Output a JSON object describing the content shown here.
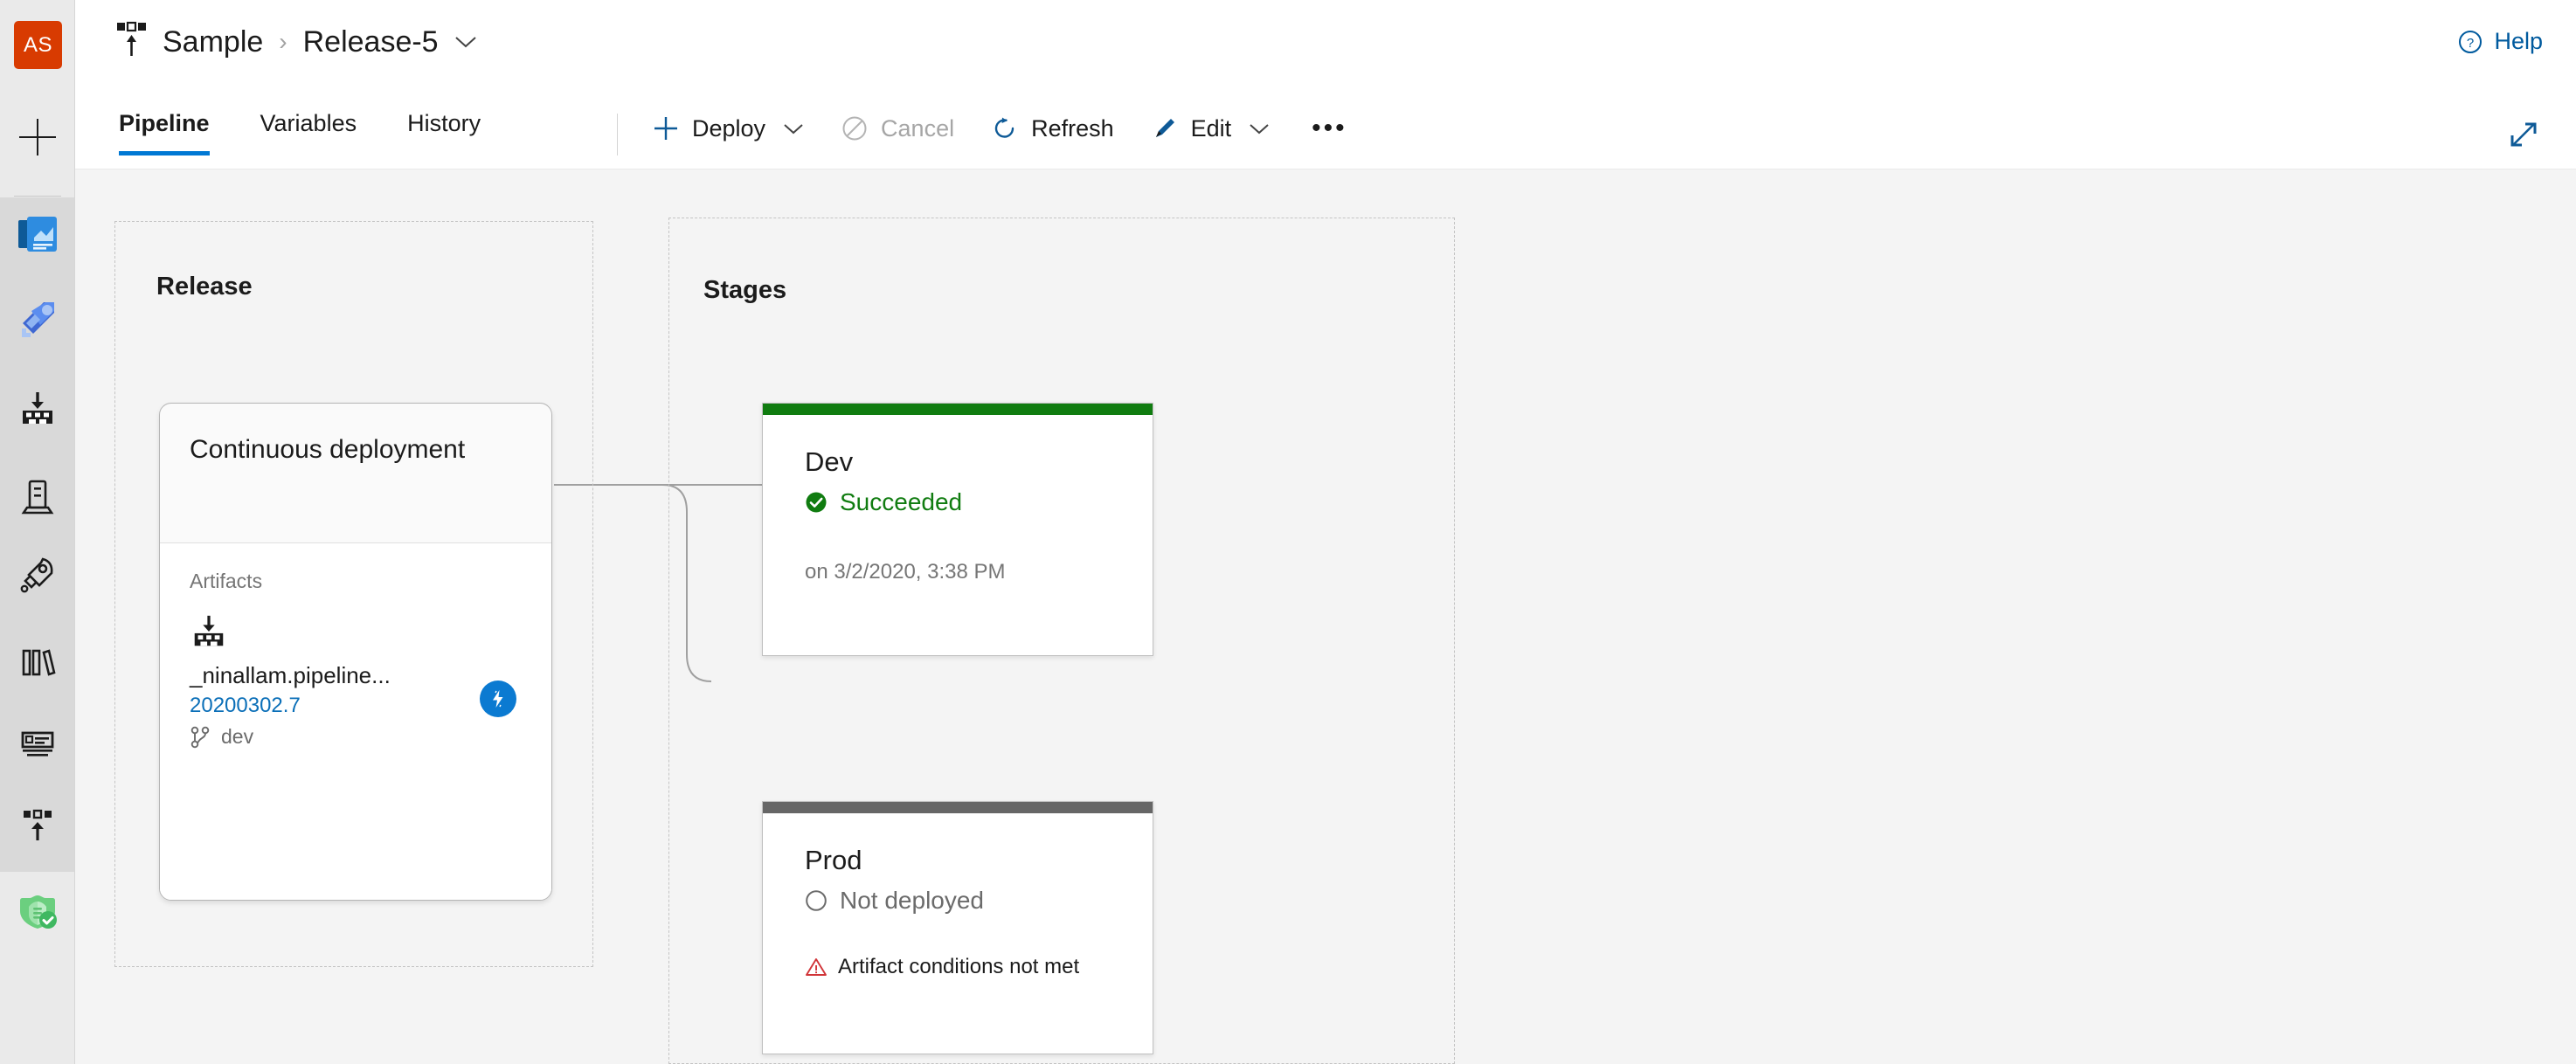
{
  "rail": {
    "avatar_initials": "AS",
    "items": [
      {
        "name": "add-icon",
        "label": "New"
      },
      {
        "name": "boards-icon",
        "label": "Boards"
      },
      {
        "name": "pipelines-icon",
        "label": "Pipelines"
      },
      {
        "name": "artifact-download-icon",
        "label": "Artifacts"
      },
      {
        "name": "server-icon",
        "label": "Deployment groups"
      },
      {
        "name": "rocket-icon",
        "label": "Releases"
      },
      {
        "name": "library-icon",
        "label": "Library"
      },
      {
        "name": "task-groups-icon",
        "label": "Task groups"
      },
      {
        "name": "artifact-upload-icon",
        "label": "Artifacts"
      },
      {
        "name": "security-shield-icon",
        "label": "Security"
      }
    ]
  },
  "header": {
    "breadcrumb_icon": "release-pipeline-icon",
    "project": "Sample",
    "separator": "›",
    "release": "Release-5",
    "chevron": "chevron-down-icon",
    "help_label": "Help",
    "help_icon": "help-circle-icon"
  },
  "toolbar": {
    "tabs": [
      {
        "label": "Pipeline",
        "active": true
      },
      {
        "label": "Variables",
        "active": false
      },
      {
        "label": "History",
        "active": false
      }
    ],
    "buttons": [
      {
        "label": "Deploy",
        "icon": "plus-icon",
        "chevron": true,
        "disabled": false
      },
      {
        "label": "Cancel",
        "icon": "cancel-circle-icon",
        "chevron": false,
        "disabled": true
      },
      {
        "label": "Refresh",
        "icon": "refresh-icon",
        "chevron": false,
        "disabled": false
      },
      {
        "label": "Edit",
        "icon": "pencil-icon",
        "chevron": true,
        "disabled": false
      }
    ],
    "overflow_label": "•••",
    "expand_icon": "expand-diagonal-icon"
  },
  "canvas": {
    "release_group": {
      "title": "Release",
      "card": {
        "title": "Continuous deployment",
        "artifacts_label": "Artifacts",
        "artifact": {
          "icon": "artifact-download-icon",
          "name": "_ninallam.pipeline...",
          "version": "20200302.7",
          "branch_icon": "branch-icon",
          "branch": "dev",
          "trigger_icon": "lightning-bolt-icon"
        }
      }
    },
    "stages_group": {
      "title": "Stages",
      "stages": [
        {
          "name": "Dev",
          "bar_color": "#107c10",
          "status_icon": "check-circle-icon",
          "status_text": "Succeeded",
          "status_color": "#107c10",
          "meta": "on 3/2/2020, 3:38 PM"
        },
        {
          "name": "Prod",
          "bar_color": "#666666",
          "status_icon": "empty-circle-icon",
          "status_text": "Not deployed",
          "status_color": "#6b6b6b",
          "warning_icon": "warning-triangle-icon",
          "warning_text": "Artifact conditions not met",
          "warning_color": "#d13438"
        }
      ]
    }
  },
  "colors": {
    "accent": "#0078d4",
    "link": "#005a9e",
    "success": "#107c10",
    "danger": "#d13438",
    "brand_avatar": "#d83b01",
    "canvas_bg": "#f4f4f4"
  }
}
